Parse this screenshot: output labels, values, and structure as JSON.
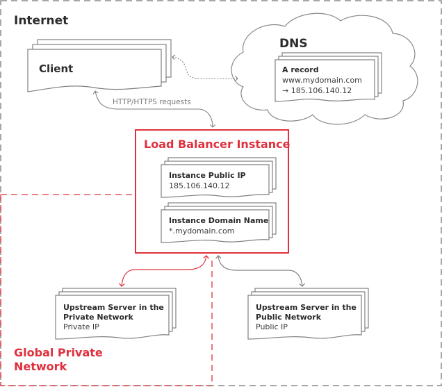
{
  "zones": {
    "internet": {
      "label": "Internet",
      "color": "#8a8a8a"
    },
    "private_network": {
      "label_line1": "Global Private",
      "label_line2": "Network",
      "color": "#e0303d"
    }
  },
  "nodes": {
    "client": {
      "title": "Client"
    },
    "dns": {
      "title": "DNS",
      "record_title": "A record",
      "record_domain": "www.mydomain.com",
      "record_ip": "→ 185.106.140.12"
    },
    "load_balancer": {
      "title": "Load Balancer Instance",
      "public_ip_title": "Instance Public IP",
      "public_ip_value": "185.106.140.12",
      "domain_title": "Instance Domain Name",
      "domain_value": "*.mydomain.com",
      "color": "#e0303d"
    },
    "upstream_private": {
      "title_line1": "Upstream Server in the",
      "title_line2": "Private Network",
      "subtitle": "Private IP"
    },
    "upstream_public": {
      "title_line1": "Upstream Server in the",
      "title_line2": "Public Network",
      "subtitle": "Public IP"
    }
  },
  "edges": {
    "client_lb": {
      "label": "HTTP/HTTPS requests"
    },
    "client_dns": {
      "style": "dotted"
    },
    "lb_private": {
      "color": "#e0303d"
    },
    "lb_public": {
      "color": "#808080"
    }
  }
}
